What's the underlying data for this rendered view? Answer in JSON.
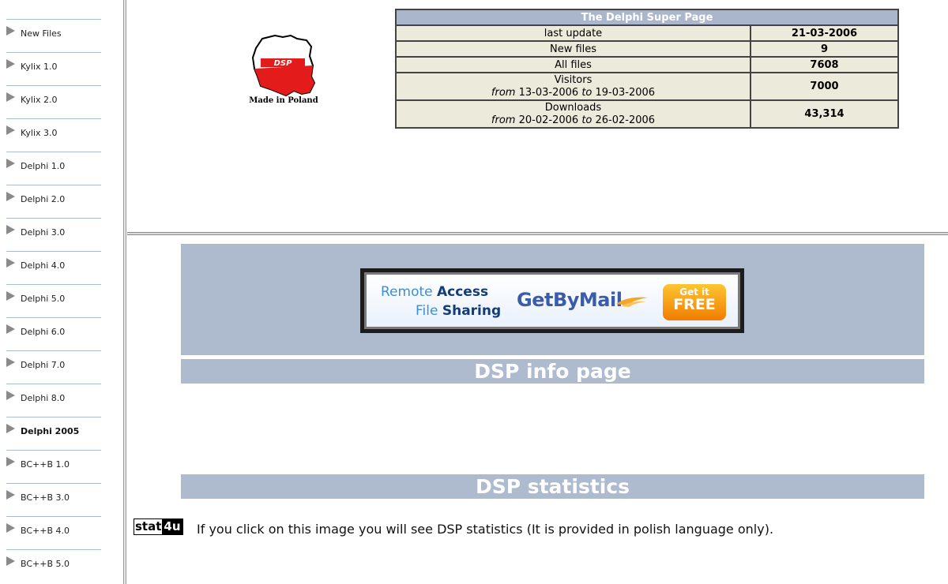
{
  "sidebar": {
    "items": [
      {
        "label": "New Files",
        "bold": false
      },
      {
        "label": "Kylix 1.0",
        "bold": false
      },
      {
        "label": "Kylix 2.0",
        "bold": false
      },
      {
        "label": "Kylix 3.0",
        "bold": false
      },
      {
        "label": "Delphi 1.0",
        "bold": false
      },
      {
        "label": "Delphi 2.0",
        "bold": false
      },
      {
        "label": "Delphi 3.0",
        "bold": false
      },
      {
        "label": "Delphi 4.0",
        "bold": false
      },
      {
        "label": "Delphi 5.0",
        "bold": false
      },
      {
        "label": "Delphi 6.0",
        "bold": false
      },
      {
        "label": "Delphi 7.0",
        "bold": false
      },
      {
        "label": "Delphi 8.0",
        "bold": false
      },
      {
        "label": "Delphi 2005",
        "bold": true
      },
      {
        "label": "BC++B 1.0",
        "bold": false
      },
      {
        "label": "BC++B 3.0",
        "bold": false
      },
      {
        "label": "BC++B 4.0",
        "bold": false
      },
      {
        "label": "BC++B 5.0",
        "bold": false
      }
    ]
  },
  "logo": {
    "text": "DSP",
    "caption": "Made in Poland"
  },
  "stats": {
    "title": "The Delphi Super Page",
    "last_update_label": "last update",
    "last_update_value": "21-03-2006",
    "new_files_label": "New files",
    "new_files_value": "9",
    "all_files_label": "All files",
    "all_files_value": "7608",
    "visitors_label": "Visitors",
    "visitors_from_word": "from",
    "visitors_from": "13-03-2006",
    "visitors_to_word": "to",
    "visitors_to": "19-03-2006",
    "visitors_value": "7000",
    "downloads_label": "Downloads",
    "downloads_from_word": "from",
    "downloads_from": "20-02-2006",
    "downloads_to_word": "to",
    "downloads_to": "26-02-2006",
    "downloads_value": "43,314"
  },
  "ad": {
    "remote": "Remote",
    "access": "Access",
    "file": "File",
    "sharing": "Sharing",
    "brand": "GetByMail",
    "cta_small": "Get it",
    "cta_large": "FREE"
  },
  "info": {
    "title": "DSP info page"
  },
  "statistics": {
    "title": "DSP statistics",
    "logo_left": "stat",
    "logo_right": "4u",
    "text": "If you click on this image you will see DSP statistics (It is provided in polish language only)."
  },
  "colors": {
    "bar": "#aebacd",
    "table_cell": "#eceadb",
    "table_header": "#a9b6cb"
  }
}
